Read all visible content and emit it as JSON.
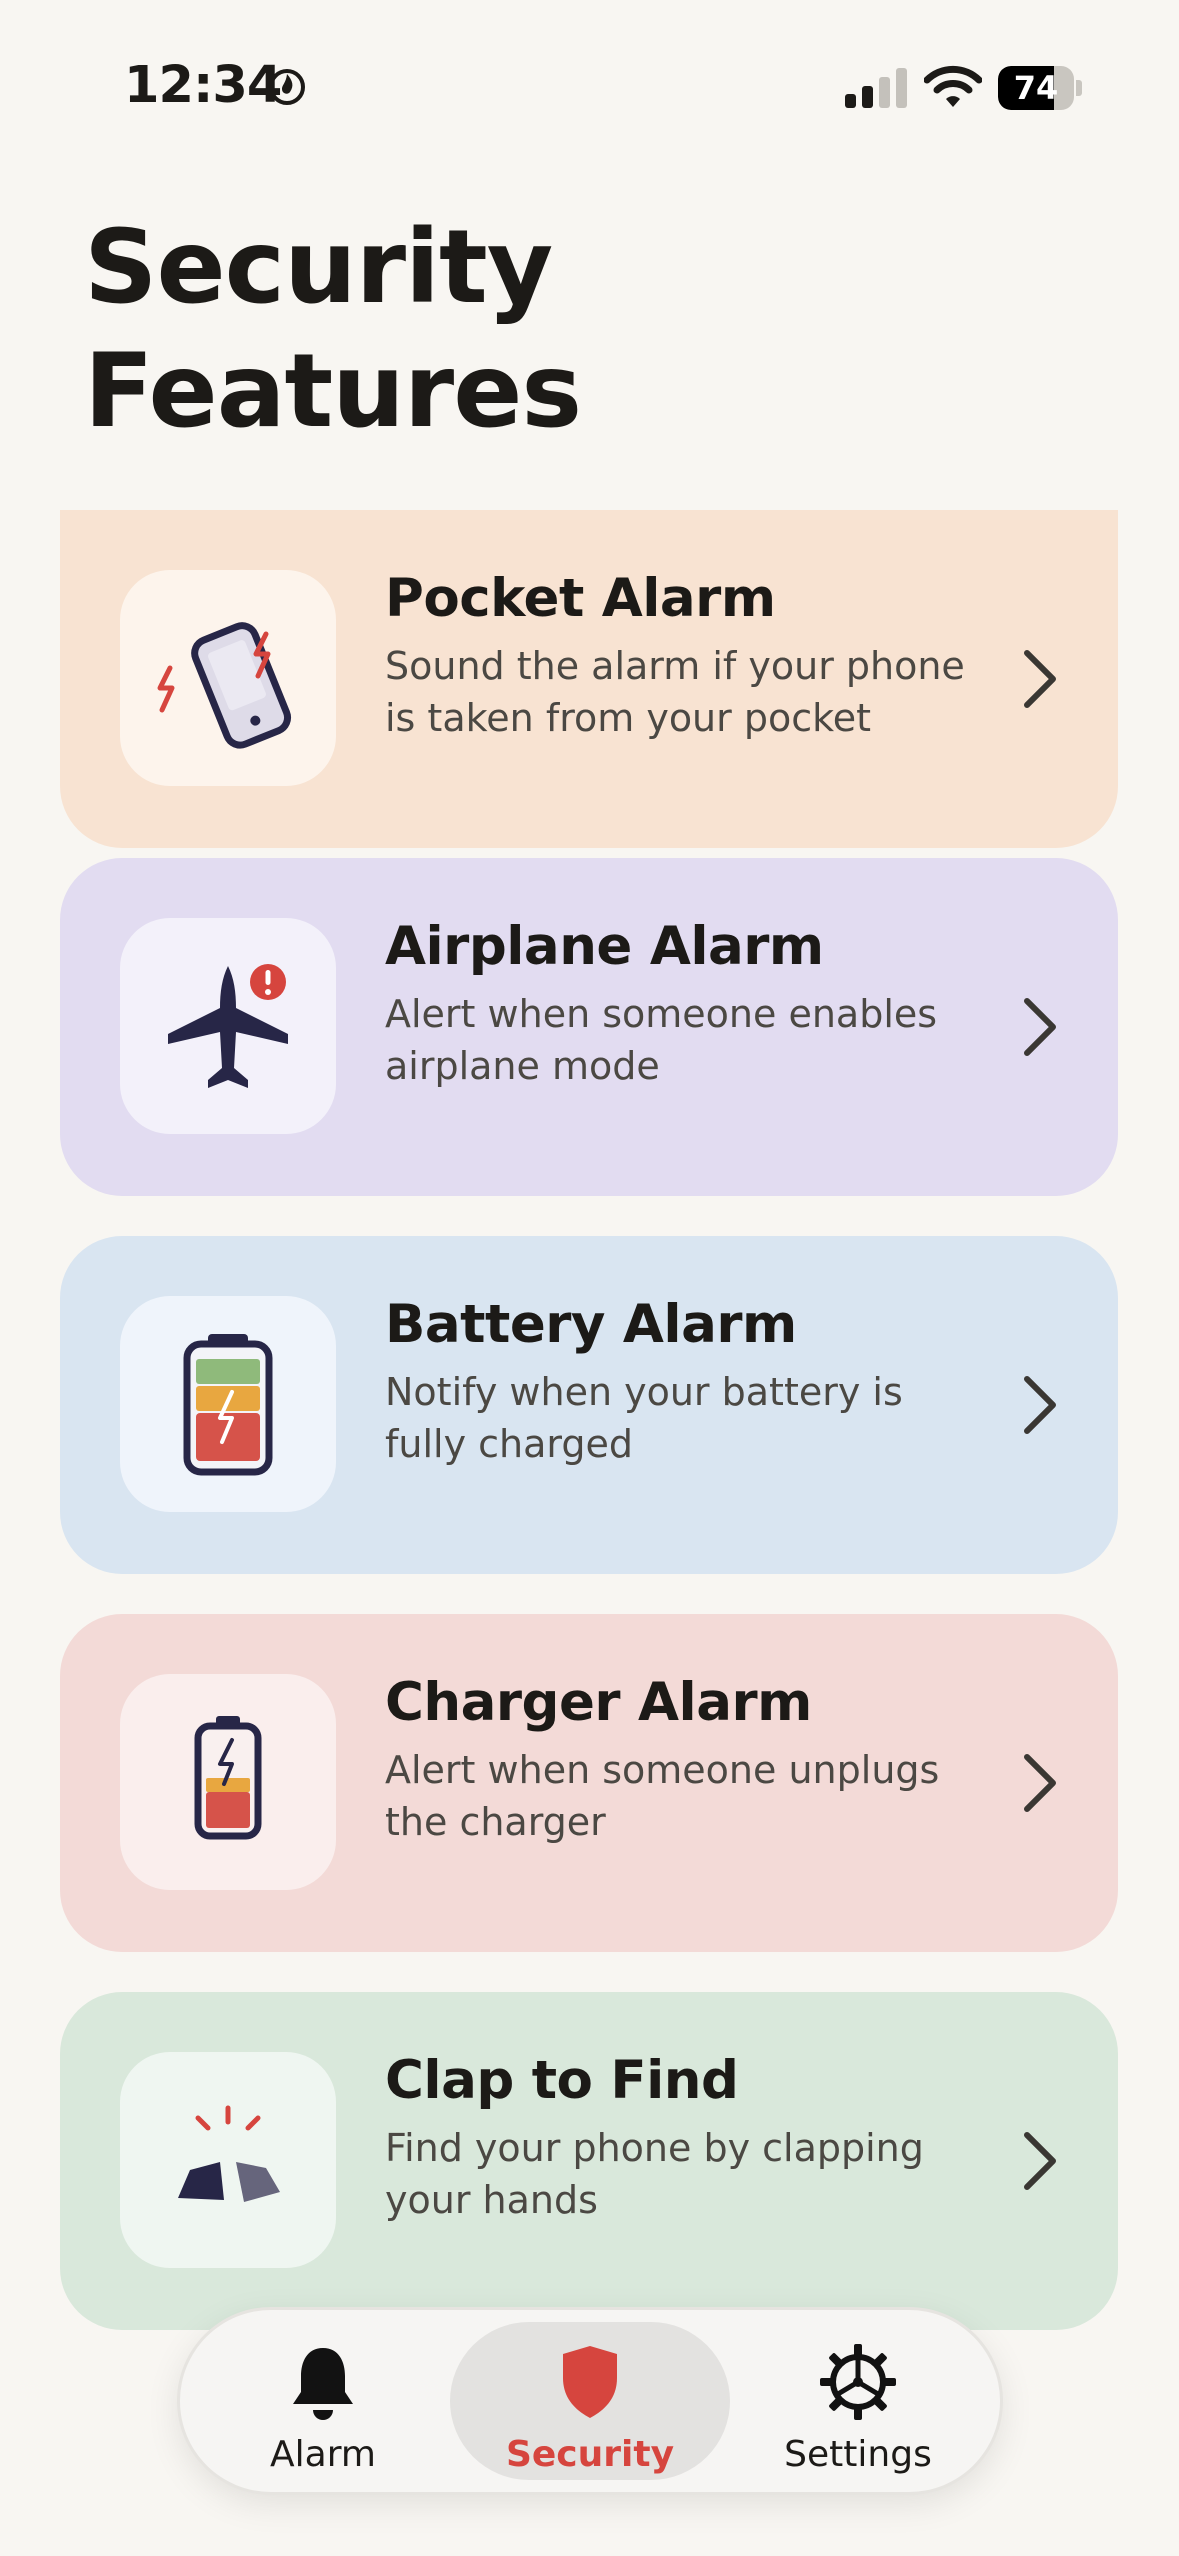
{
  "status_bar": {
    "time": "12:34",
    "battery_level": "74",
    "battery_fraction": 0.74
  },
  "page": {
    "title": "Security Features"
  },
  "features": [
    {
      "title": "Pocket Alarm",
      "description": "Sound the alarm if your phone is taken from your pocket",
      "icon": "phone-shake-icon",
      "bg": "#f8e3d2",
      "tile_bg": "#fdf4ec"
    },
    {
      "title": "Airplane Alarm",
      "description": "Alert when someone enables airplane mode",
      "icon": "airplane-alert-icon",
      "bg": "#e2dcf1",
      "tile_bg": "#f3f1fa"
    },
    {
      "title": "Battery Alarm",
      "description": "Notify when your battery is fully charged",
      "icon": "battery-charge-icon",
      "bg": "#d9e5f1",
      "tile_bg": "#eff4fb"
    },
    {
      "title": "Charger Alarm",
      "description": "Alert when someone unplugs the charger",
      "icon": "charger-unplug-icon",
      "bg": "#f3dad7",
      "tile_bg": "#faeeed"
    },
    {
      "title": "Clap to Find",
      "description": "Find your phone by clapping your hands",
      "icon": "clapping-hands-icon",
      "bg": "#d9e8db",
      "tile_bg": "#eff6f1"
    }
  ],
  "tab_bar": {
    "tabs": [
      {
        "label": "Alarm",
        "icon": "bell-icon",
        "active": false
      },
      {
        "label": "Security",
        "icon": "shield-icon",
        "active": true
      },
      {
        "label": "Settings",
        "icon": "gear-icon",
        "active": false
      }
    ]
  },
  "colors": {
    "accent": "#d6453e",
    "navy": "#272647",
    "background": "#f8f6f2"
  }
}
